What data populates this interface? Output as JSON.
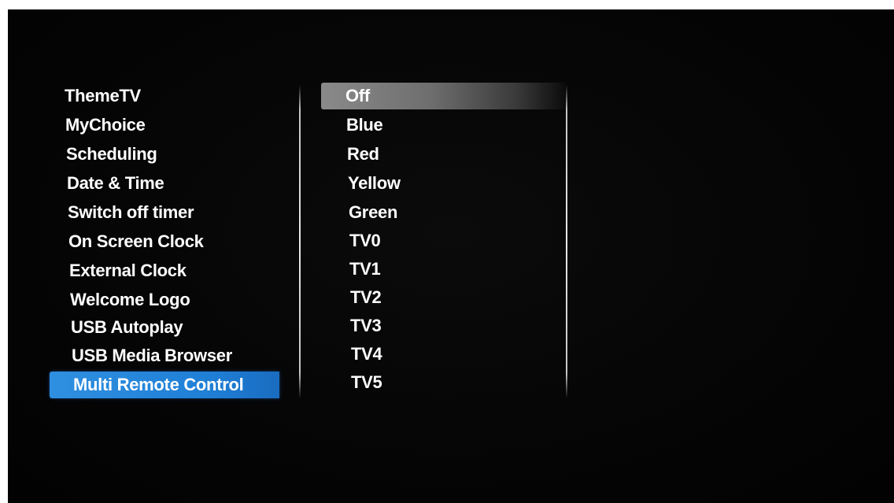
{
  "menu": {
    "items": [
      {
        "label": "ThemeTV"
      },
      {
        "label": "MyChoice"
      },
      {
        "label": "Scheduling"
      },
      {
        "label": "Date & Time"
      },
      {
        "label": "Switch off timer"
      },
      {
        "label": "On Screen Clock"
      },
      {
        "label": "External Clock"
      },
      {
        "label": "Welcome Logo"
      },
      {
        "label": "USB Autoplay"
      },
      {
        "label": "USB Media Browser"
      },
      {
        "label": "Multi Remote Control"
      }
    ],
    "selected": "Multi Remote Control"
  },
  "options": {
    "items": [
      {
        "label": "Off"
      },
      {
        "label": "Blue"
      },
      {
        "label": "Red"
      },
      {
        "label": "Yellow"
      },
      {
        "label": "Green"
      },
      {
        "label": "TV0"
      },
      {
        "label": "TV1"
      },
      {
        "label": "TV2"
      },
      {
        "label": "TV3"
      },
      {
        "label": "TV4"
      },
      {
        "label": "TV5"
      }
    ],
    "highlighted": "Off"
  },
  "colors": {
    "selection_blue": "#1f7fd6",
    "highlight_gray": "#7a7a7a",
    "background": "#050505",
    "text": "#ffffff"
  }
}
